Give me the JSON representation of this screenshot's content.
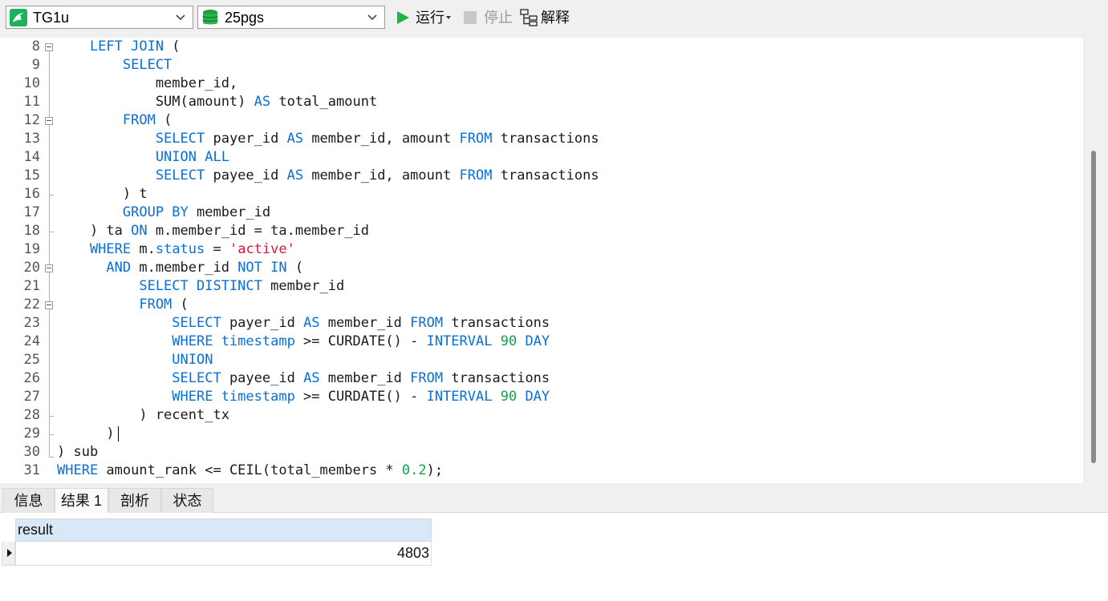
{
  "toolbar": {
    "connection": {
      "value": "TG1u",
      "icon": "mysql-dolphin-icon"
    },
    "database": {
      "value": "25pgs",
      "icon": "database-icon"
    },
    "run_label": "运行",
    "stop_label": "停止",
    "explain_label": "解释"
  },
  "editor": {
    "lines": [
      {
        "no": "8",
        "tokens": [
          [
            "k",
            "    LEFT JOIN"
          ],
          [
            "t",
            " ("
          ]
        ]
      },
      {
        "no": "9",
        "tokens": [
          [
            "k",
            "        SELECT"
          ]
        ]
      },
      {
        "no": "10",
        "tokens": [
          [
            "t",
            "            member_id,"
          ]
        ]
      },
      {
        "no": "11",
        "tokens": [
          [
            "t",
            "            SUM(amount) "
          ],
          [
            "k",
            "AS"
          ],
          [
            "t",
            " total_amount"
          ]
        ]
      },
      {
        "no": "12",
        "tokens": [
          [
            "k",
            "        FROM"
          ],
          [
            "t",
            " ("
          ]
        ]
      },
      {
        "no": "13",
        "tokens": [
          [
            "k",
            "            SELECT"
          ],
          [
            "t",
            " payer_id "
          ],
          [
            "k",
            "AS"
          ],
          [
            "t",
            " member_id, amount "
          ],
          [
            "k",
            "FROM"
          ],
          [
            "t",
            " transactions"
          ]
        ]
      },
      {
        "no": "14",
        "tokens": [
          [
            "k",
            "            UNION ALL"
          ]
        ]
      },
      {
        "no": "15",
        "tokens": [
          [
            "k",
            "            SELECT"
          ],
          [
            "t",
            " payee_id "
          ],
          [
            "k",
            "AS"
          ],
          [
            "t",
            " member_id, amount "
          ],
          [
            "k",
            "FROM"
          ],
          [
            "t",
            " transactions"
          ]
        ]
      },
      {
        "no": "16",
        "tokens": [
          [
            "t",
            "        ) t"
          ]
        ]
      },
      {
        "no": "17",
        "tokens": [
          [
            "k",
            "        GROUP BY"
          ],
          [
            "t",
            " member_id"
          ]
        ]
      },
      {
        "no": "18",
        "tokens": [
          [
            "t",
            "    ) ta "
          ],
          [
            "k",
            "ON"
          ],
          [
            "t",
            " m.member_id = ta.member_id"
          ]
        ]
      },
      {
        "no": "19",
        "tokens": [
          [
            "k",
            "    WHERE"
          ],
          [
            "t",
            " m."
          ],
          [
            "k",
            "status"
          ],
          [
            "t",
            " = "
          ],
          [
            "s",
            "'active'"
          ]
        ]
      },
      {
        "no": "20",
        "tokens": [
          [
            "k",
            "      AND"
          ],
          [
            "t",
            " m.member_id "
          ],
          [
            "k",
            "NOT IN"
          ],
          [
            "t",
            " ("
          ]
        ]
      },
      {
        "no": "21",
        "tokens": [
          [
            "k",
            "          SELECT DISTINCT"
          ],
          [
            "t",
            " member_id"
          ]
        ]
      },
      {
        "no": "22",
        "tokens": [
          [
            "k",
            "          FROM"
          ],
          [
            "t",
            " ("
          ]
        ]
      },
      {
        "no": "23",
        "tokens": [
          [
            "k",
            "              SELECT"
          ],
          [
            "t",
            " payer_id "
          ],
          [
            "k",
            "AS"
          ],
          [
            "t",
            " member_id "
          ],
          [
            "k",
            "FROM"
          ],
          [
            "t",
            " transactions"
          ]
        ]
      },
      {
        "no": "24",
        "tokens": [
          [
            "k",
            "              WHERE timestamp"
          ],
          [
            "t",
            " >= CURDATE() - "
          ],
          [
            "k",
            "INTERVAL"
          ],
          [
            "t",
            " "
          ],
          [
            "n",
            "90"
          ],
          [
            "t",
            " "
          ],
          [
            "k",
            "DAY"
          ]
        ]
      },
      {
        "no": "25",
        "tokens": [
          [
            "k",
            "              UNION"
          ]
        ]
      },
      {
        "no": "26",
        "tokens": [
          [
            "k",
            "              SELECT"
          ],
          [
            "t",
            " payee_id "
          ],
          [
            "k",
            "AS"
          ],
          [
            "t",
            " member_id "
          ],
          [
            "k",
            "FROM"
          ],
          [
            "t",
            " transactions"
          ]
        ]
      },
      {
        "no": "27",
        "tokens": [
          [
            "k",
            "              WHERE timestamp"
          ],
          [
            "t",
            " >= CURDATE() - "
          ],
          [
            "k",
            "INTERVAL"
          ],
          [
            "t",
            " "
          ],
          [
            "n",
            "90"
          ],
          [
            "t",
            " "
          ],
          [
            "k",
            "DAY"
          ]
        ]
      },
      {
        "no": "28",
        "tokens": [
          [
            "t",
            "          ) recent_tx"
          ]
        ]
      },
      {
        "no": "29",
        "tokens": [
          [
            "t",
            "      )"
          ]
        ]
      },
      {
        "no": "30",
        "tokens": [
          [
            "t",
            ") sub"
          ]
        ]
      },
      {
        "no": "31",
        "tokens": [
          [
            "k",
            "WHERE"
          ],
          [
            "t",
            " amount_rank <= CEIL(total_members * "
          ],
          [
            "n",
            "0.2"
          ],
          [
            "t",
            ");"
          ]
        ]
      }
    ]
  },
  "result_tabs": [
    "信息",
    "结果 1",
    "剖析",
    "状态"
  ],
  "result_grid": {
    "columns": [
      "result"
    ],
    "rows": [
      [
        "4803"
      ]
    ]
  },
  "colors": {
    "keyword": "#0a6fd6",
    "string": "#e0153a",
    "number": "#10a64a",
    "grid_header": "#d9e8f6",
    "run_green": "#1fb14a"
  }
}
